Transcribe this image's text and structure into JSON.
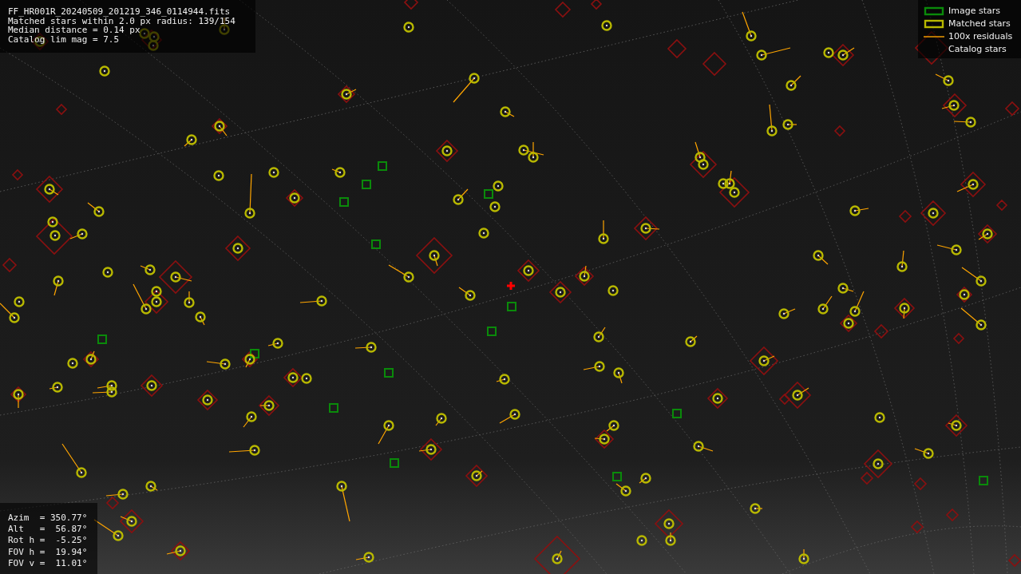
{
  "info_lines": [
    "FF_HR001R_20240509_201219_346_0114944.fits",
    "Matched stars within 2.0 px radius: 139/154",
    "Median distance = 0.14 px",
    "Catalog lim mag = 7.5"
  ],
  "legend": [
    {
      "kind": "image",
      "label": "Image stars"
    },
    {
      "kind": "matched",
      "label": "Matched stars"
    },
    {
      "kind": "residual",
      "label": "100x residuals"
    },
    {
      "kind": "catalog",
      "label": "Catalog stars"
    }
  ],
  "pointing_lines": [
    "Azim  = 350.77°",
    "Alt   =  56.87°",
    "Rot h =  -5.25°",
    "FOV h =  19.94°",
    "FOV v =  11.01°"
  ]
}
